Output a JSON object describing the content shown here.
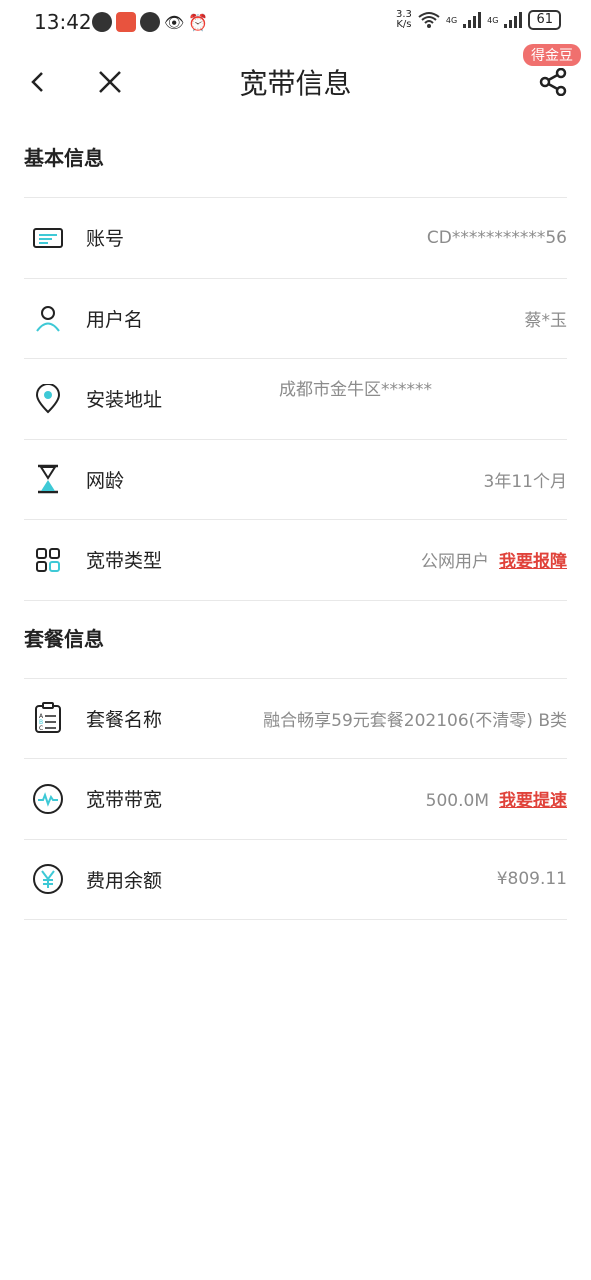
{
  "status_bar": {
    "time": "13:42",
    "speed": "3.3",
    "speed_unit": "K/s",
    "network_1": "4G",
    "network_2": "4G",
    "battery": "61"
  },
  "nav": {
    "title": "宽带信息",
    "badge": "得金豆"
  },
  "sections": {
    "basic": {
      "title": "基本信息",
      "account": {
        "label": "账号",
        "value": "CD***********56"
      },
      "username": {
        "label": "用户名",
        "value": "蔡*玉"
      },
      "address": {
        "label": "安装地址",
        "value": "成都市金牛区******"
      },
      "age": {
        "label": "网龄",
        "value": "3年11个月"
      },
      "type": {
        "label": "宽带类型",
        "value": "公网用户",
        "action": "我要报障"
      }
    },
    "package": {
      "title": "套餐信息",
      "name": {
        "label": "套餐名称",
        "value": "融合畅享59元套餐202106(不清零) B类"
      },
      "bandwidth": {
        "label": "宽带带宽",
        "value": "500.0M",
        "action": "我要提速"
      },
      "balance": {
        "label": "费用余额",
        "value": "¥809.11"
      }
    }
  },
  "colors": {
    "accent": "#3ec9d6",
    "link": "#e0423a",
    "badge": "#f0706e"
  }
}
